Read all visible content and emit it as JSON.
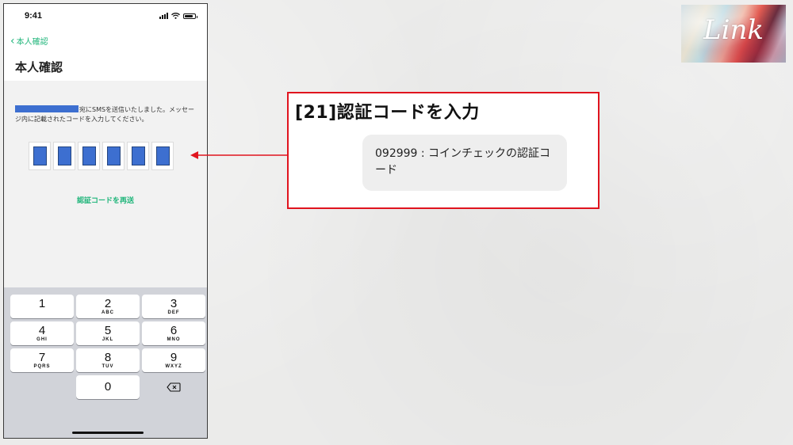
{
  "status": {
    "time": "9:41",
    "battery_level": 0.85
  },
  "nav": {
    "back_label": "本人確認",
    "title": "本人確認"
  },
  "sms_instruction": "宛にSMSを送信いたしました。メッセージ内に記載されたコードを入力してください。",
  "code_input": {
    "length": 6,
    "fill_color": "#3d6fd0"
  },
  "resend_label": "認証コードを再送",
  "keypad": {
    "keys": [
      {
        "num": "1",
        "letters": ""
      },
      {
        "num": "2",
        "letters": "ABC"
      },
      {
        "num": "3",
        "letters": "DEF"
      },
      {
        "num": "4",
        "letters": "GHI"
      },
      {
        "num": "5",
        "letters": "JKL"
      },
      {
        "num": "6",
        "letters": "MNO"
      },
      {
        "num": "7",
        "letters": "PQRS"
      },
      {
        "num": "8",
        "letters": "TUV"
      },
      {
        "num": "9",
        "letters": "WXYZ"
      },
      {
        "num": "0",
        "letters": ""
      }
    ],
    "delete_icon": "backspace-icon"
  },
  "callout": {
    "title": "[21]認証コードを入力",
    "sms_text": "092999 : コインチェックの認証コード",
    "border_color": "#e0141e"
  },
  "logo": {
    "text": "Link"
  },
  "colors": {
    "accent": "#1fb57a",
    "redaction": "#3d6fd0"
  }
}
